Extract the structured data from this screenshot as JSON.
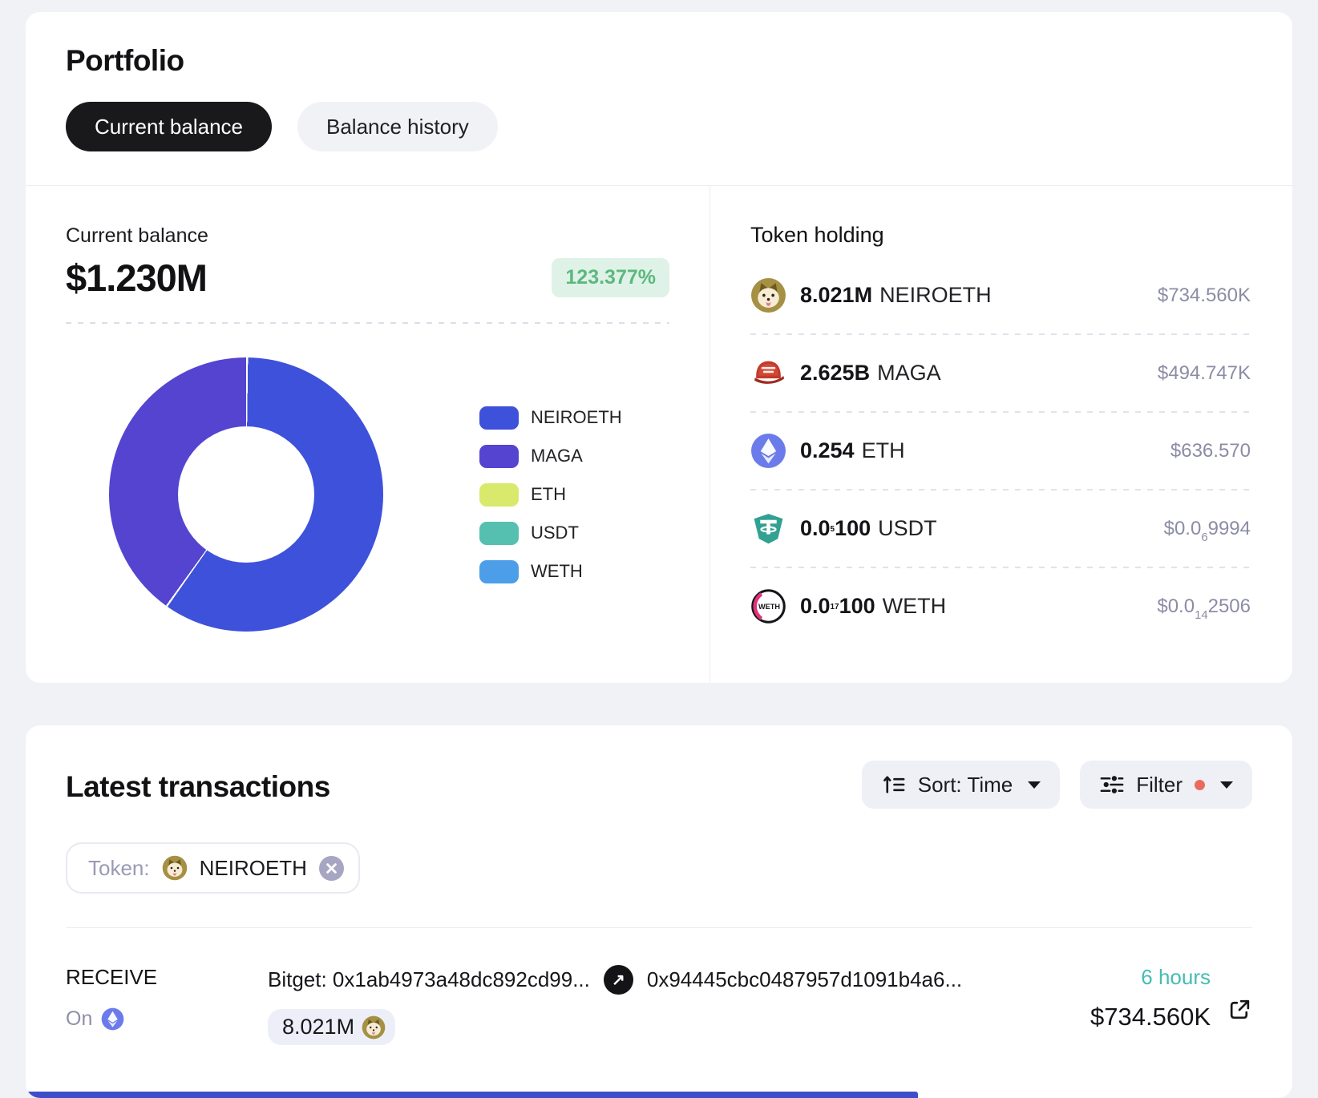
{
  "portfolio": {
    "title": "Portfolio",
    "tabs": [
      {
        "label": "Current balance"
      },
      {
        "label": "Balance history"
      }
    ],
    "balance": {
      "label": "Current balance",
      "value": "$1.230M",
      "change_pct": "123.377%"
    },
    "chart_data": {
      "type": "pie",
      "donut": true,
      "labels": [
        "NEIROETH",
        "MAGA",
        "ETH",
        "USDT",
        "WETH"
      ],
      "values_usd": [
        734560,
        494747,
        636.57,
        9.994e-07,
        2.5056e-15
      ],
      "percentages": [
        59.72,
        40.22,
        0.05,
        0,
        0
      ],
      "colors": [
        "#3E51DB",
        "#5444D0",
        "#D9E96B",
        "#55C0B0",
        "#4C9EE8"
      ],
      "legend_position": "right",
      "title": ""
    },
    "token_holding": {
      "title": "Token holding",
      "rows": [
        {
          "icon": "neiroeth-token-icon",
          "amount": "8.021M",
          "amount_sub": "",
          "amount_tail": "",
          "symbol": "NEIROETH",
          "value": "$734.560K",
          "value_sub": "",
          "value_tail": ""
        },
        {
          "icon": "maga-token-icon",
          "amount": "2.625B",
          "amount_sub": "",
          "amount_tail": "",
          "symbol": "MAGA",
          "value": "$494.747K",
          "value_sub": "",
          "value_tail": ""
        },
        {
          "icon": "eth-token-icon",
          "amount": "0.254",
          "amount_sub": "",
          "amount_tail": "",
          "symbol": "ETH",
          "value": "$636.570",
          "value_sub": "",
          "value_tail": ""
        },
        {
          "icon": "usdt-token-icon",
          "amount": "0.0",
          "amount_sub": "5",
          "amount_tail": "100",
          "symbol": "USDT",
          "value": "$0.0",
          "value_sub": "6",
          "value_tail": "9994"
        },
        {
          "icon": "weth-token-icon",
          "amount": "0.0",
          "amount_sub": "17",
          "amount_tail": "100",
          "symbol": "WETH",
          "value": "$0.0",
          "value_sub": "14",
          "value_tail": "2506"
        }
      ]
    }
  },
  "transactions": {
    "title": "Latest transactions",
    "sort_button": {
      "label": "Sort: Time"
    },
    "filter_button": {
      "label": "Filter",
      "active_indicator": true
    },
    "token_filter": {
      "prefix": "Token:",
      "token": "NEIROETH"
    },
    "rows": [
      {
        "direction": "RECEIVE",
        "chain_prefix": "On",
        "chain": "ETH",
        "from": "Bitget: 0x1ab4973a48dc892cd99...",
        "to": "0x94445cbc0487957d1091b4a6...",
        "amount": "8.021M",
        "amount_token": "NEIROETH",
        "time": "6 hours",
        "usd_value": "$734.560K"
      }
    ]
  },
  "icons": {
    "transfer_arrow": "↗"
  }
}
